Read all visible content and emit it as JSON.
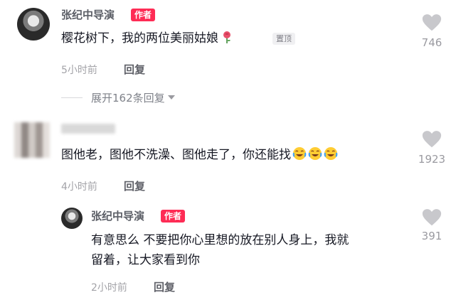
{
  "comments": [
    {
      "username": "张纪中导演",
      "badge": "作者",
      "content": "樱花树下，我的两位美丽姑娘",
      "pin_label": "置顶",
      "time": "5小时前",
      "reply_label": "回复",
      "likes": "746",
      "expand_label": "展开162条回复",
      "content_icon": "rose-icon"
    },
    {
      "username": "",
      "content": "图他老，图他不洗澡、图他走了，你还能找",
      "time": "4小时前",
      "reply_label": "回复",
      "likes": "1923",
      "content_icon": "crying-laughing-emoji",
      "replies": [
        {
          "username": "张纪中导演",
          "badge": "作者",
          "content_line1": "有意思么 不要把你心里想的放在别人身上，我就",
          "content_line2": "留着，让大家看到你",
          "time": "2小时前",
          "reply_label": "回复",
          "likes": "391"
        }
      ]
    }
  ],
  "colors": {
    "accent": "#fe2c55",
    "heart": "#c8c8cc"
  }
}
